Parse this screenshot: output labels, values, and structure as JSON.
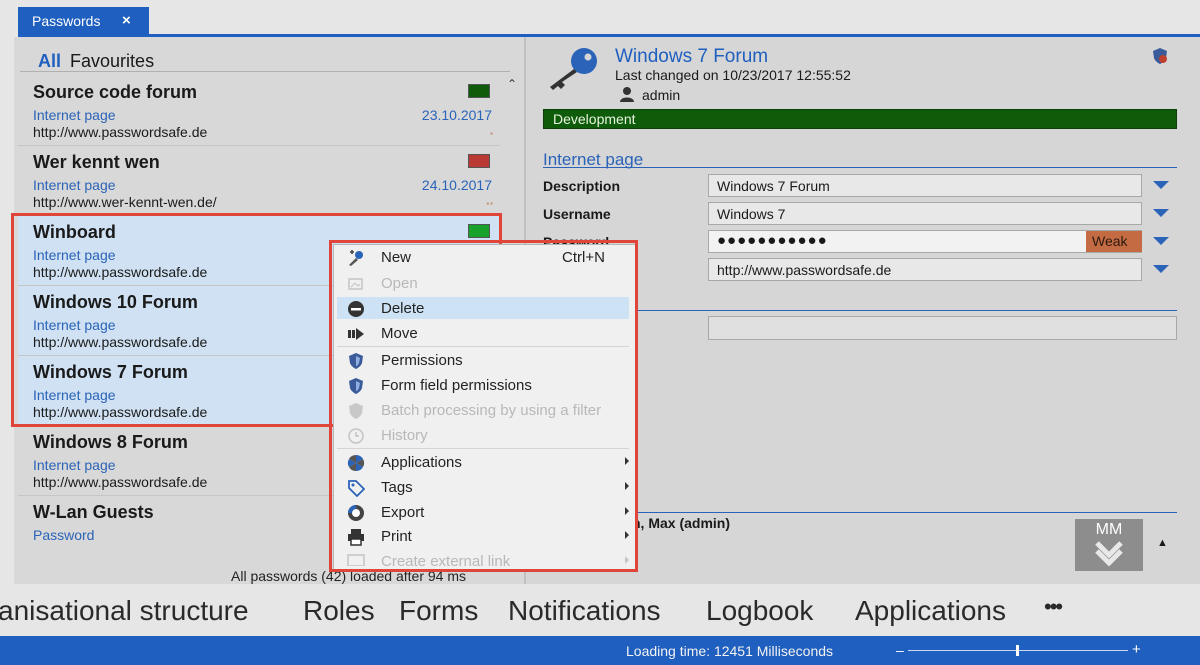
{
  "tab": {
    "title": "Passwords",
    "close": "×"
  },
  "filter": {
    "all": "All",
    "favourites": "Favourites"
  },
  "entries": [
    {
      "name": "Source code forum",
      "type": "Internet page",
      "date": "23.10.2017",
      "url": "http://www.passwordsafe.de",
      "color": "#0e5c0a",
      "dots": "▪"
    },
    {
      "name": "Wer kennt wen",
      "type": "Internet page",
      "date": "24.10.2017",
      "url": "http://www.wer-kennt-wen.de/",
      "color": "#b83a32",
      "dots": "▪▪"
    },
    {
      "name": "Winboard",
      "type": "Internet page",
      "date": "",
      "url": "http://www.passwordsafe.de",
      "color": "#18a12b",
      "dots": ""
    },
    {
      "name": "Windows 10 Forum",
      "type": "Internet page",
      "date": "",
      "url": "http://www.passwordsafe.de",
      "color": "",
      "dots": ""
    },
    {
      "name": "Windows 7 Forum",
      "type": "Internet page",
      "date": "",
      "url": "http://www.passwordsafe.de",
      "color": "",
      "dots": ""
    },
    {
      "name": "Windows 8 Forum",
      "type": "Internet page",
      "date": "",
      "url": "http://www.passwordsafe.de",
      "color": "",
      "dots": ""
    },
    {
      "name": "W-Lan Guests",
      "type": "Password",
      "date": "",
      "url": "",
      "color": "",
      "dots": ""
    }
  ],
  "list_footer": "All passwords (42) loaded after 94 ms",
  "detail": {
    "title": "Windows 7 Forum",
    "changed": "Last changed on 10/23/2017 12:55:52",
    "user": "admin",
    "tag": "Development",
    "section": "Internet page",
    "fields": [
      {
        "label": "Description",
        "value": "Windows 7 Forum"
      },
      {
        "label": "Username",
        "value": "Windows 7"
      },
      {
        "label": "Password",
        "value": "●●●●●●●●●●●"
      },
      {
        "label": "",
        "value": "http://www.passwordsafe.de"
      }
    ],
    "strength": "Weak",
    "owner": "n, Max (admin)",
    "avatar": "MM"
  },
  "context_menu": {
    "new": "New",
    "new_shortcut": "Ctrl+N",
    "open": "Open",
    "delete": "Delete",
    "move": "Move",
    "permissions": "Permissions",
    "form_field_permissions": "Form field permissions",
    "batch": "Batch processing by using a filter",
    "history": "History",
    "applications": "Applications",
    "tags": "Tags",
    "export": "Export",
    "print": "Print",
    "external_link": "Create external link"
  },
  "nav": [
    "anisational structure",
    "Roles",
    "Forms",
    "Notifications",
    "Logbook",
    "Applications",
    "•••"
  ],
  "status": {
    "loading": "Loading time: 12451 Milliseconds",
    "minus": "–",
    "plus": "+"
  }
}
